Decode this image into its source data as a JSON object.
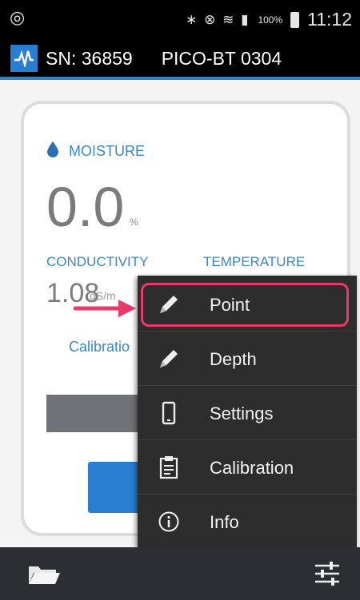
{
  "status_bar": {
    "left_icon": "circular-app-icon",
    "system_icons": "∗ ⊗ ≋ ▮",
    "battery": "100%",
    "time": "11:12"
  },
  "app_bar": {
    "serial": "SN: 36859",
    "device": "PICO-BT 0304"
  },
  "card": {
    "moisture_label": "MOISTURE",
    "moisture_value": "0.0",
    "moisture_unit": "%",
    "conductivity_label": "CONDUCTIVITY",
    "temperature_label": "TEMPERATURE",
    "conductivity_value": "1.08",
    "conductivity_unit": "dS/m",
    "calibration_text": "Calibratio"
  },
  "menu": {
    "items": [
      {
        "label": "Point",
        "icon": "pencil-icon"
      },
      {
        "label": "Depth",
        "icon": "pencil-icon"
      },
      {
        "label": "Settings",
        "icon": "phone-icon"
      },
      {
        "label": "Calibration",
        "icon": "clipboard-icon"
      },
      {
        "label": "Info",
        "icon": "info-icon"
      }
    ]
  },
  "colors": {
    "accent": "#3b87c8",
    "highlight": "#e63a6a",
    "menu_bg": "#2d2d2d",
    "bottom_bar": "#2b2e33"
  }
}
